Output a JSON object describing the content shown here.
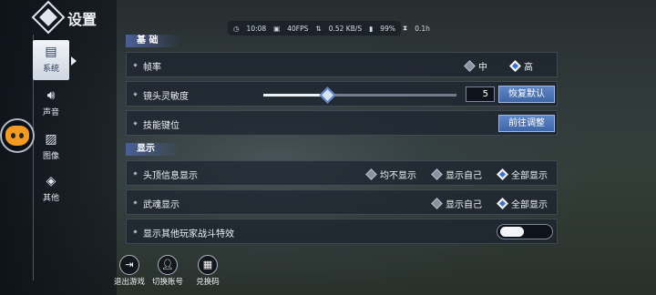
{
  "header": {
    "title": "设置"
  },
  "status_bar": {
    "time": "10:08",
    "fps": "40FPS",
    "network": "0.52 KB/S",
    "battery": "99%",
    "duration": "0.1h"
  },
  "nav": [
    {
      "label": "系统",
      "icon": "document-gear-icon"
    },
    {
      "label": "声音",
      "icon": "speaker-icon"
    },
    {
      "label": "图像",
      "icon": "image-icon"
    },
    {
      "label": "其他",
      "icon": "layers-icon"
    }
  ],
  "sections": {
    "basic": "基 础",
    "display": "显示"
  },
  "rows": {
    "framerate": {
      "label": "帧率",
      "options": [
        "中",
        "高"
      ],
      "selected": "高"
    },
    "sensitivity": {
      "label": "镜头灵敏度",
      "value": "5",
      "level": 0.33,
      "reset_label": "恢复默认"
    },
    "skill_keys": {
      "label": "技能键位",
      "button_label": "前往调整"
    },
    "head_info": {
      "label": "头顶信息显示",
      "options": [
        "均不显示",
        "显示自己",
        "全部显示"
      ],
      "selected": "全部显示"
    },
    "soul_display": {
      "label": "武魂显示",
      "options": [
        "显示自己",
        "全部显示"
      ],
      "selected": "全部显示"
    },
    "combat_fx": {
      "label": "显示其他玩家战斗特效",
      "enabled": true
    }
  },
  "bottom": {
    "exit": "退出游戏",
    "switch_account": "切换账号",
    "redeem": "兑换码"
  }
}
